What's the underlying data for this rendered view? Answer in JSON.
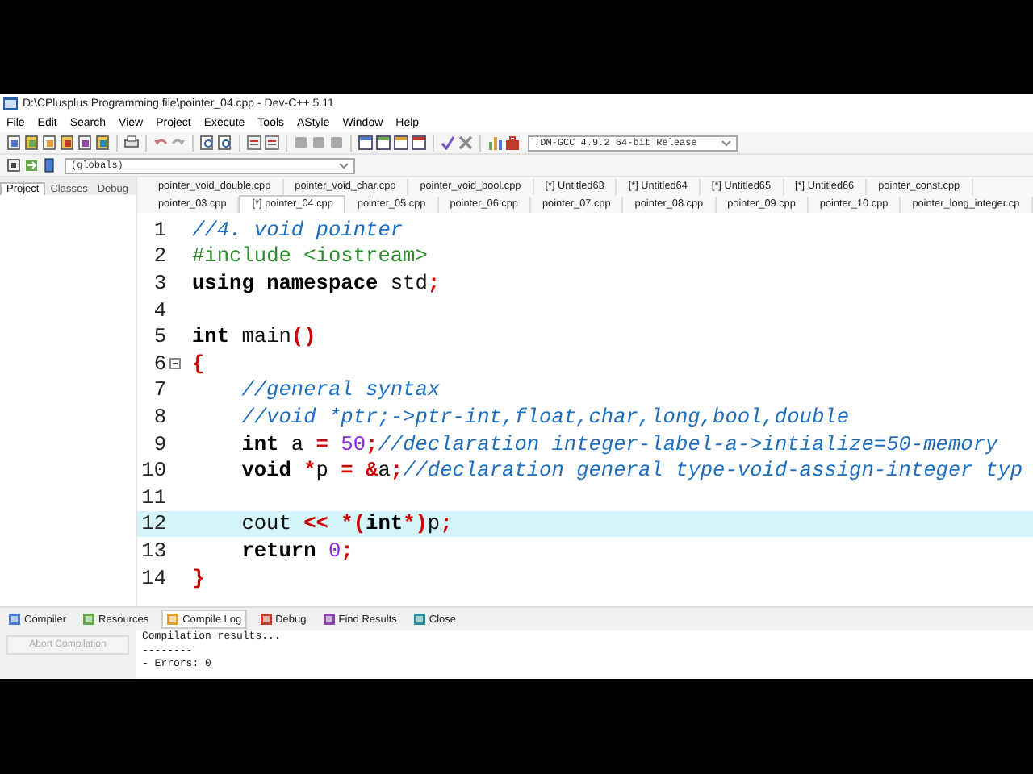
{
  "window": {
    "title": "D:\\CPlusplus Programming file\\pointer_04.cpp - Dev-C++ 5.11"
  },
  "menu": [
    "File",
    "Edit",
    "Search",
    "View",
    "Project",
    "Execute",
    "Tools",
    "AStyle",
    "Window",
    "Help"
  ],
  "toolbar": {
    "compiler_select": "TDM-GCC 4.9.2 64-bit Release",
    "scope_select": "(globals)"
  },
  "side_tabs": [
    {
      "label": "Project",
      "selected": true
    },
    {
      "label": "Classes",
      "selected": false
    },
    {
      "label": "Debug",
      "selected": false
    }
  ],
  "file_tabs": [
    [
      {
        "label": "pointer_void_double.cpp",
        "selected": false
      },
      {
        "label": "pointer_void_char.cpp",
        "selected": false
      },
      {
        "label": "pointer_void_bool.cpp",
        "selected": false
      },
      {
        "label": "[*] Untitled63",
        "selected": false
      },
      {
        "label": "[*] Untitled64",
        "selected": false
      },
      {
        "label": "[*] Untitled65",
        "selected": false
      },
      {
        "label": "[*] Untitled66",
        "selected": false
      },
      {
        "label": "pointer_const.cpp",
        "selected": false
      }
    ],
    [
      {
        "label": "pointer_03.cpp",
        "selected": false
      },
      {
        "label": "[*] pointer_04.cpp",
        "selected": true
      },
      {
        "label": "pointer_05.cpp",
        "selected": false
      },
      {
        "label": "pointer_06.cpp",
        "selected": false
      },
      {
        "label": "pointer_07.cpp",
        "selected": false
      },
      {
        "label": "pointer_08.cpp",
        "selected": false
      },
      {
        "label": "pointer_09.cpp",
        "selected": false
      },
      {
        "label": "pointer_10.cpp",
        "selected": false
      },
      {
        "label": "pointer_long_integer.cp",
        "selected": false
      }
    ]
  ],
  "code_lines": [
    {
      "number": "1",
      "current": false,
      "fold": false,
      "indented": false,
      "tokens": [
        {
          "kind": "comment",
          "text": "//4. void pointer"
        }
      ]
    },
    {
      "number": "2",
      "current": false,
      "fold": false,
      "indented": false,
      "tokens": [
        {
          "kind": "preprocessor",
          "text": "#include <iostream>"
        }
      ]
    },
    {
      "number": "3",
      "current": false,
      "fold": false,
      "indented": false,
      "tokens": [
        {
          "kind": "keyword",
          "text": "using namespace"
        },
        {
          "kind": "plain",
          "text": " std"
        },
        {
          "kind": "symbol",
          "text": ";"
        }
      ]
    },
    {
      "number": "4",
      "current": false,
      "fold": false
    },
    {
      "number": "5",
      "current": false,
      "fold": false,
      "indented": false,
      "tokens": [
        {
          "kind": "keyword",
          "text": "int"
        },
        {
          "kind": "plain",
          "text": " main"
        },
        {
          "kind": "symbol",
          "text": "()"
        }
      ]
    },
    {
      "number": "6",
      "current": false,
      "fold": true,
      "indented": false,
      "tokens": [
        {
          "kind": "symbol",
          "text": "{"
        }
      ]
    },
    {
      "number": "7",
      "current": false,
      "fold": false,
      "indented": true,
      "tokens": [
        {
          "kind": "comment",
          "text": "//general syntax"
        }
      ]
    },
    {
      "number": "8",
      "current": false,
      "fold": false,
      "indented": true,
      "tokens": [
        {
          "kind": "comment",
          "text": "//void *ptr;->ptr-int,float,char,long,bool,double"
        }
      ]
    },
    {
      "number": "9",
      "current": false,
      "fold": false,
      "indented": true,
      "tokens": [
        {
          "kind": "keyword",
          "text": "int"
        },
        {
          "kind": "plain",
          "text": " a "
        },
        {
          "kind": "symbol",
          "text": "="
        },
        {
          "kind": "number",
          "text": " 50"
        },
        {
          "kind": "symbol",
          "text": ";"
        },
        {
          "kind": "comment",
          "text": "//declaration integer-label-a->intialize=50-memory"
        }
      ]
    },
    {
      "number": "10",
      "current": false,
      "fold": false,
      "indented": true,
      "tokens": [
        {
          "kind": "keyword",
          "text": "void"
        },
        {
          "kind": "symbol",
          "text": " *"
        },
        {
          "kind": "plain",
          "text": "p "
        },
        {
          "kind": "symbol",
          "text": "= &"
        },
        {
          "kind": "plain",
          "text": "a"
        },
        {
          "kind": "symbol",
          "text": ";"
        },
        {
          "kind": "comment",
          "text": "//declaration general type-void-assign-integer typ"
        }
      ]
    },
    {
      "number": "11",
      "current": false,
      "fold": false
    },
    {
      "number": "12",
      "current": true,
      "fold": false,
      "indented": true,
      "tokens": [
        {
          "kind": "plain",
          "text": "cout "
        },
        {
          "kind": "symbol",
          "text": "<< *("
        },
        {
          "kind": "keyword",
          "text": "int"
        },
        {
          "kind": "symbol",
          "text": "*)"
        },
        {
          "kind": "plain",
          "text": "p"
        },
        {
          "kind": "symbol",
          "text": ";"
        }
      ]
    },
    {
      "number": "13",
      "current": false,
      "fold": false,
      "indented": true,
      "tokens": [
        {
          "kind": "keyword",
          "text": "return"
        },
        {
          "kind": "number",
          "text": " 0"
        },
        {
          "kind": "symbol",
          "text": ";"
        }
      ]
    },
    {
      "number": "14",
      "current": false,
      "fold": false,
      "indented": false,
      "tokens": [
        {
          "kind": "symbol",
          "text": "}"
        }
      ]
    }
  ],
  "bottom_tabs": [
    {
      "label": "Compiler",
      "selected": false
    },
    {
      "label": "Resources",
      "selected": false
    },
    {
      "label": "Compile Log",
      "selected": true
    },
    {
      "label": "Debug",
      "selected": false
    },
    {
      "label": "Find Results",
      "selected": false
    },
    {
      "label": "Close",
      "selected": false
    }
  ],
  "abort_button": {
    "label": "Abort Compilation",
    "disabled": true
  },
  "log_lines": [
    "Compilation results...",
    "--------",
    "- Errors: 0"
  ]
}
